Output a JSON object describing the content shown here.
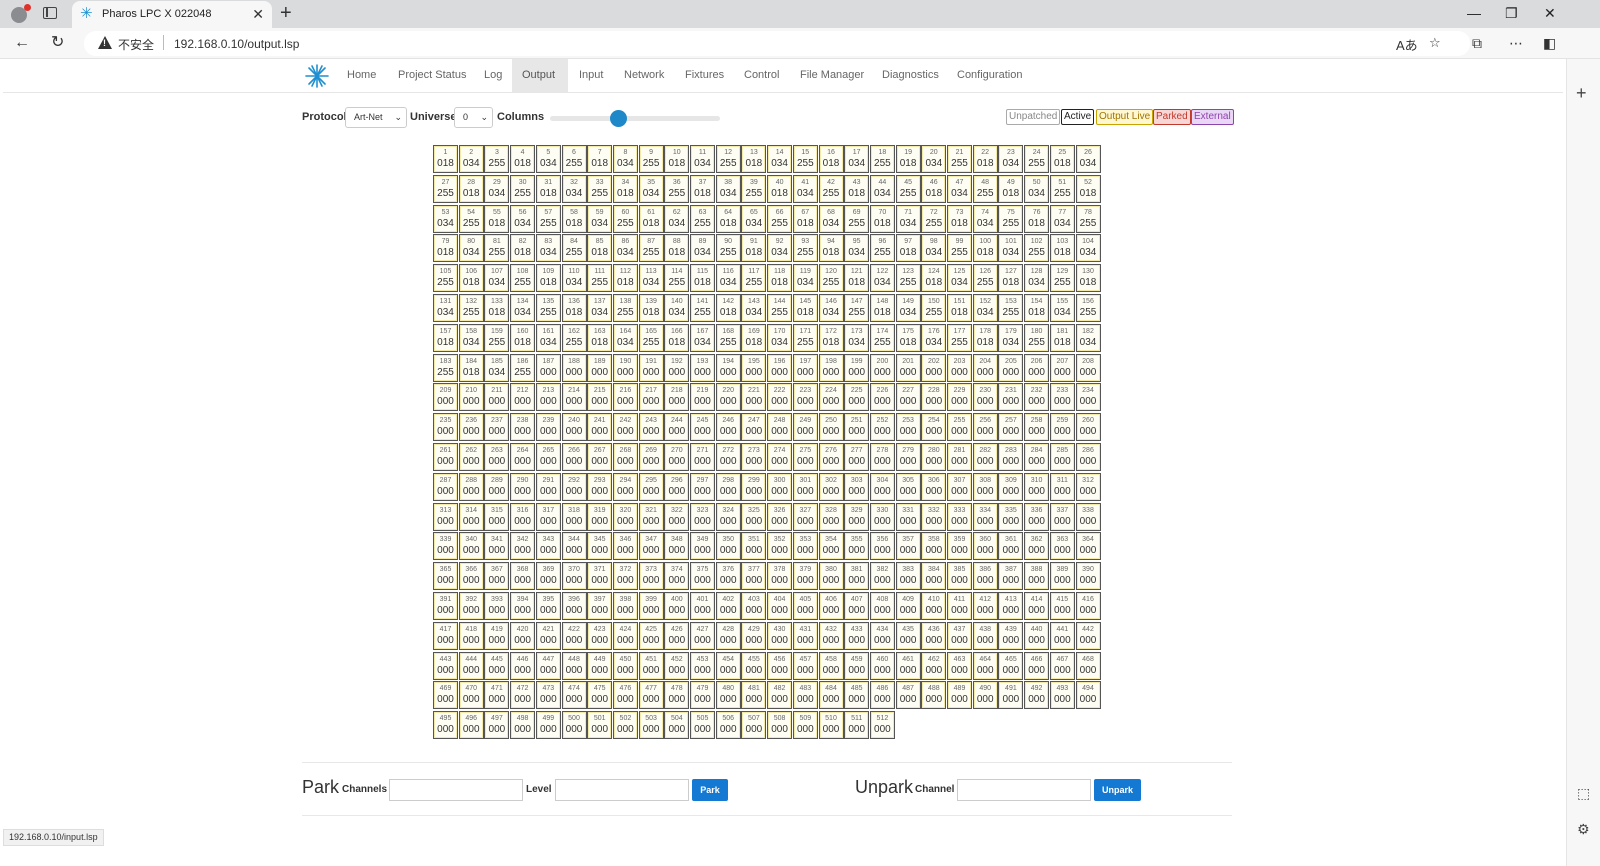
{
  "browser": {
    "tab_title": "Pharos LPC X 022048",
    "insecure_label": "不安全",
    "url": "192.168.0.10/output.lsp",
    "status_url": "192.168.0.10/input.lsp"
  },
  "nav": {
    "items": [
      "Home",
      "Project Status",
      "Log",
      "Output",
      "Input",
      "Network",
      "Fixtures",
      "Control",
      "File Manager",
      "Diagnostics",
      "Configuration"
    ],
    "active": "Output"
  },
  "toolbar": {
    "protocol_label": "Protocol",
    "protocol_value": "Art-Net",
    "universe_label": "Universe",
    "universe_value": "0",
    "columns_label": "Columns",
    "columns_slider_fraction": 0.4
  },
  "legend": {
    "unpatched": "Unpatched",
    "active": "Active",
    "output_live": "Output Live",
    "parked": "Parked",
    "external": "External"
  },
  "colors": {
    "unpatched": "#888888",
    "active": "#222222",
    "output_live": "#b8860b",
    "parked": "#c0392b",
    "external": "#8e44ad",
    "parked_bg": "#f9d6d6",
    "output_live_bg": "#fff7d0",
    "external_bg": "#ead6f5",
    "accent": "#1479d3"
  },
  "channels": {
    "columns": 26,
    "total": 512,
    "pattern": [
      "018",
      "034",
      "255"
    ],
    "pattern_length": 186
  },
  "park": {
    "title": "Park",
    "channels_label": "Channels",
    "level_label": "Level",
    "button": "Park"
  },
  "unpark": {
    "title": "Unpark",
    "channel_label": "Channel",
    "button": "Unpark"
  }
}
